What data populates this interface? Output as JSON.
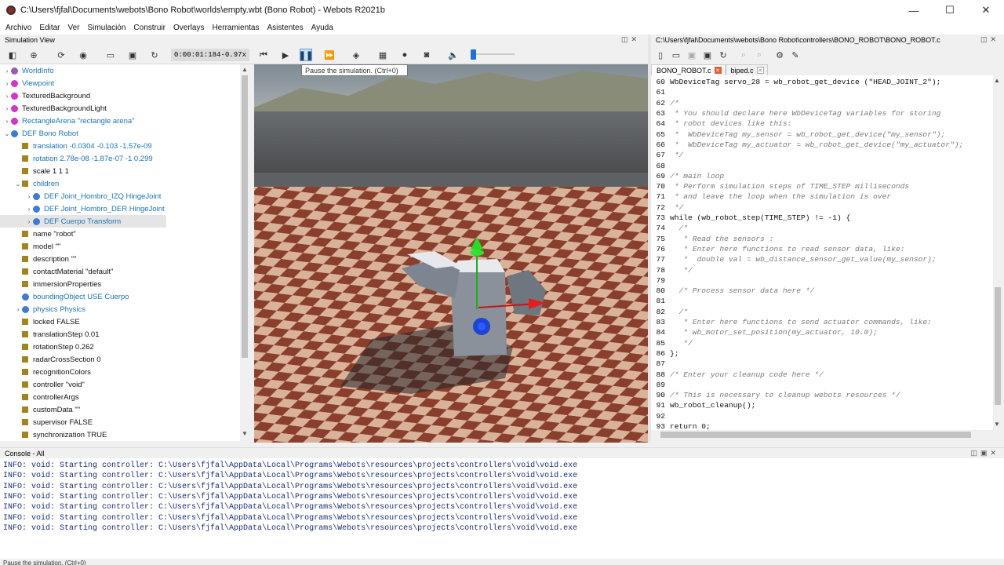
{
  "window": {
    "title": "C:\\Users\\fjfal\\Documents\\webots\\Bono Robot\\worlds\\empty.wbt (Bono Robot) - Webots R2021b",
    "minimize": "—",
    "maximize": "☐",
    "close": "✕"
  },
  "menu": [
    "Archivo",
    "Editar",
    "Ver",
    "Simulación",
    "Construir",
    "Overlays",
    "Herramientas",
    "Asistentes",
    "Ayuda"
  ],
  "simulation_view": {
    "title": "Simulation View",
    "time": "0:00:01:184",
    "separator": "-",
    "speed": "0.97x",
    "tooltip": "Pause the simulation. (Ctrl+0)"
  },
  "scene_tree": [
    {
      "label": "WorldInfo",
      "indent": 0,
      "arrow": "›",
      "marker": "dot",
      "color": "#9b59b6",
      "text_color": "#1a73b8"
    },
    {
      "label": "Viewpoint",
      "indent": 0,
      "arrow": "›",
      "marker": "dot",
      "color": "#d633c9",
      "text_color": "#1a73b8"
    },
    {
      "label": "TexturedBackground",
      "indent": 0,
      "arrow": "›",
      "marker": "dot",
      "color": "#d633c9",
      "text_color": "#111"
    },
    {
      "label": "TexturedBackgroundLight",
      "indent": 0,
      "arrow": "›",
      "marker": "dot",
      "color": "#d633c9",
      "text_color": "#111"
    },
    {
      "label": "RectangleArena \"rectangle arena\"",
      "indent": 0,
      "arrow": "›",
      "marker": "dot",
      "color": "#d633c9",
      "text_color": "#1a73b8"
    },
    {
      "label": "DEF Bono Robot",
      "indent": 0,
      "arrow": "⌄",
      "marker": "dot",
      "color": "#3a7bd5",
      "text_color": "#1a73b8"
    },
    {
      "label": "translation -0.0304 -0.103 -1.57e-09",
      "indent": 1,
      "arrow": "",
      "marker": "sq",
      "color": "#a0851e",
      "text_color": "#1a73b8"
    },
    {
      "label": "rotation 2.78e-08 -1.87e-07 -1 0.299",
      "indent": 1,
      "arrow": "",
      "marker": "sq",
      "color": "#a0851e",
      "text_color": "#1a73b8"
    },
    {
      "label": "scale 1 1 1",
      "indent": 1,
      "arrow": "",
      "marker": "sq",
      "color": "#a0851e",
      "text_color": "#111"
    },
    {
      "label": "children",
      "indent": 1,
      "arrow": "⌄",
      "marker": "sq",
      "color": "#a0851e",
      "text_color": "#1a73b8"
    },
    {
      "label": "DEF Joint_Hombro_IZQ HingeJoint",
      "indent": 2,
      "arrow": "›",
      "marker": "dot",
      "color": "#3a7bd5",
      "text_color": "#1a73b8"
    },
    {
      "label": "DEF Joint_Hombro_DER HingeJoint",
      "indent": 2,
      "arrow": "›",
      "marker": "dot",
      "color": "#3a7bd5",
      "text_color": "#1a73b8"
    },
    {
      "label": "DEF Cuerpo Transform",
      "indent": 2,
      "arrow": "›",
      "marker": "dot",
      "color": "#3a7bd5",
      "text_color": "#1a73b8",
      "selected": true
    },
    {
      "label": "name \"robot\"",
      "indent": 1,
      "arrow": "",
      "marker": "sq",
      "color": "#a0851e",
      "text_color": "#111"
    },
    {
      "label": "model \"\"",
      "indent": 1,
      "arrow": "",
      "marker": "sq",
      "color": "#a0851e",
      "text_color": "#111"
    },
    {
      "label": "description \"\"",
      "indent": 1,
      "arrow": "",
      "marker": "sq",
      "color": "#a0851e",
      "text_color": "#111"
    },
    {
      "label": "contactMaterial \"default\"",
      "indent": 1,
      "arrow": "",
      "marker": "sq",
      "color": "#a0851e",
      "text_color": "#111"
    },
    {
      "label": "immersionProperties",
      "indent": 1,
      "arrow": "",
      "marker": "sq",
      "color": "#a0851e",
      "text_color": "#111"
    },
    {
      "label": "boundingObject USE Cuerpo",
      "indent": 1,
      "arrow": "",
      "marker": "dot",
      "color": "#3a7bd5",
      "text_color": "#1a73b8"
    },
    {
      "label": "physics Physics",
      "indent": 1,
      "arrow": "›",
      "marker": "dot",
      "color": "#3a7bd5",
      "text_color": "#1a73b8"
    },
    {
      "label": "locked FALSE",
      "indent": 1,
      "arrow": "",
      "marker": "sq",
      "color": "#a0851e",
      "text_color": "#111"
    },
    {
      "label": "translationStep 0.01",
      "indent": 1,
      "arrow": "",
      "marker": "sq",
      "color": "#a0851e",
      "text_color": "#111"
    },
    {
      "label": "rotationStep 0.262",
      "indent": 1,
      "arrow": "",
      "marker": "sq",
      "color": "#a0851e",
      "text_color": "#111"
    },
    {
      "label": "radarCrossSection 0",
      "indent": 1,
      "arrow": "",
      "marker": "sq",
      "color": "#a0851e",
      "text_color": "#111"
    },
    {
      "label": "recognitionColors",
      "indent": 1,
      "arrow": "",
      "marker": "sq",
      "color": "#a0851e",
      "text_color": "#111"
    },
    {
      "label": "controller \"void\"",
      "indent": 1,
      "arrow": "",
      "marker": "sq",
      "color": "#a0851e",
      "text_color": "#111"
    },
    {
      "label": "controllerArgs",
      "indent": 1,
      "arrow": "",
      "marker": "sq",
      "color": "#a0851e",
      "text_color": "#111"
    },
    {
      "label": "customData \"\"",
      "indent": 1,
      "arrow": "",
      "marker": "sq",
      "color": "#a0851e",
      "text_color": "#111"
    },
    {
      "label": "supervisor FALSE",
      "indent": 1,
      "arrow": "",
      "marker": "sq",
      "color": "#a0851e",
      "text_color": "#111"
    },
    {
      "label": "synchronization TRUE",
      "indent": 1,
      "arrow": "",
      "marker": "sq",
      "color": "#a0851e",
      "text_color": "#111"
    }
  ],
  "editor": {
    "path": "C:\\Users\\fjfal\\Documents\\webots\\Bono Robot\\controllers\\BONO_ROBOT\\BONO_ROBOT.c",
    "tabs": [
      {
        "label": "BONO_ROBOT.c",
        "active": true
      },
      {
        "label": "biped.c",
        "active": false
      }
    ],
    "lines": [
      {
        "n": "60",
        "t": "WbDeviceTag servo_28 = wb_robot_get_device (\"HEAD_JOINT_2\");",
        "c": false
      },
      {
        "n": "61",
        "t": "",
        "c": false
      },
      {
        "n": "62",
        "t": "/*",
        "c": true
      },
      {
        "n": "63",
        "t": " * You should declare here WbDeviceTag variables for storing",
        "c": true
      },
      {
        "n": "64",
        "t": " * robot devices like this:",
        "c": true
      },
      {
        "n": "65",
        "t": " *  WbDeviceTag my_sensor = wb_robot_get_device(\"my_sensor\");",
        "c": true
      },
      {
        "n": "66",
        "t": " *  WbDeviceTag my_actuator = wb_robot_get_device(\"my_actuator\");",
        "c": true
      },
      {
        "n": "67",
        "t": " */",
        "c": true
      },
      {
        "n": "68",
        "t": "",
        "c": false
      },
      {
        "n": "69",
        "t": "/* main loop",
        "c": true
      },
      {
        "n": "70",
        "t": " * Perform simulation steps of TIME_STEP milliseconds",
        "c": true
      },
      {
        "n": "71",
        "t": " * and leave the loop when the simulation is over",
        "c": true
      },
      {
        "n": "72",
        "t": " */",
        "c": true
      },
      {
        "n": "73",
        "t": "while (wb_robot_step(TIME_STEP) != -1) {",
        "c": false
      },
      {
        "n": "74",
        "t": "  /*",
        "c": true
      },
      {
        "n": "75",
        "t": "   * Read the sensors :",
        "c": true
      },
      {
        "n": "76",
        "t": "   * Enter here functions to read sensor data, like:",
        "c": true
      },
      {
        "n": "77",
        "t": "   *  double val = wb_distance_sensor_get_value(my_sensor);",
        "c": true
      },
      {
        "n": "78",
        "t": "   */",
        "c": true
      },
      {
        "n": "79",
        "t": "",
        "c": false
      },
      {
        "n": "80",
        "t": "  /* Process sensor data here */",
        "c": true
      },
      {
        "n": "81",
        "t": "",
        "c": false
      },
      {
        "n": "82",
        "t": "  /*",
        "c": true
      },
      {
        "n": "83",
        "t": "   * Enter here functions to send actuator commands, like:",
        "c": true
      },
      {
        "n": "84",
        "t": "   * wb_motor_set_position(my_actuator, 10.0);",
        "c": true
      },
      {
        "n": "85",
        "t": "   */",
        "c": true
      },
      {
        "n": "86",
        "t": "};",
        "c": false
      },
      {
        "n": "87",
        "t": "",
        "c": false
      },
      {
        "n": "88",
        "t": "/* Enter your cleanup code here */",
        "c": true
      },
      {
        "n": "89",
        "t": "",
        "c": false
      },
      {
        "n": "90",
        "t": "/* This is necessary to cleanup webots resources */",
        "c": true
      },
      {
        "n": "91",
        "t": "wb_robot_cleanup();",
        "c": false
      },
      {
        "n": "92",
        "t": "",
        "c": false
      },
      {
        "n": "93",
        "t": "return 0;",
        "c": false
      }
    ]
  },
  "console": {
    "title": "Console - All",
    "lines": [
      "INFO: void: Starting controller: C:\\Users\\fjfal\\AppData\\Local\\Programs\\Webots\\resources\\projects\\controllers\\void\\void.exe",
      "INFO: void: Starting controller: C:\\Users\\fjfal\\AppData\\Local\\Programs\\Webots\\resources\\projects\\controllers\\void\\void.exe",
      "INFO: void: Starting controller: C:\\Users\\fjfal\\AppData\\Local\\Programs\\Webots\\resources\\projects\\controllers\\void\\void.exe",
      "INFO: void: Starting controller: C:\\Users\\fjfal\\AppData\\Local\\Programs\\Webots\\resources\\projects\\controllers\\void\\void.exe",
      "INFO: void: Starting controller: C:\\Users\\fjfal\\AppData\\Local\\Programs\\Webots\\resources\\projects\\controllers\\void\\void.exe",
      "INFO: void: Starting controller: C:\\Users\\fjfal\\AppData\\Local\\Programs\\Webots\\resources\\projects\\controllers\\void\\void.exe",
      "INFO: void: Starting controller: C:\\Users\\fjfal\\AppData\\Local\\Programs\\Webots\\resources\\projects\\controllers\\void\\void.exe"
    ]
  },
  "status": "Pause the simulation. (Ctrl+0)",
  "icons": {
    "toolbar": [
      "hide-tree-icon",
      "add-node-icon",
      "reload-icon",
      "view-icon",
      "open-world-icon",
      "save-world-icon",
      "revert-icon",
      "step-back-icon",
      "play-icon",
      "pause-icon",
      "fast-forward-icon",
      "step-icon",
      "record-movie-icon",
      "record-icon",
      "screenshot-icon",
      "volume-icon"
    ],
    "editor": [
      "new-file-icon",
      "open-file-icon",
      "save-icon",
      "save-all-icon",
      "revert-icon",
      "search-icon",
      "zoom-icon",
      "build-icon",
      "clean-icon"
    ]
  }
}
